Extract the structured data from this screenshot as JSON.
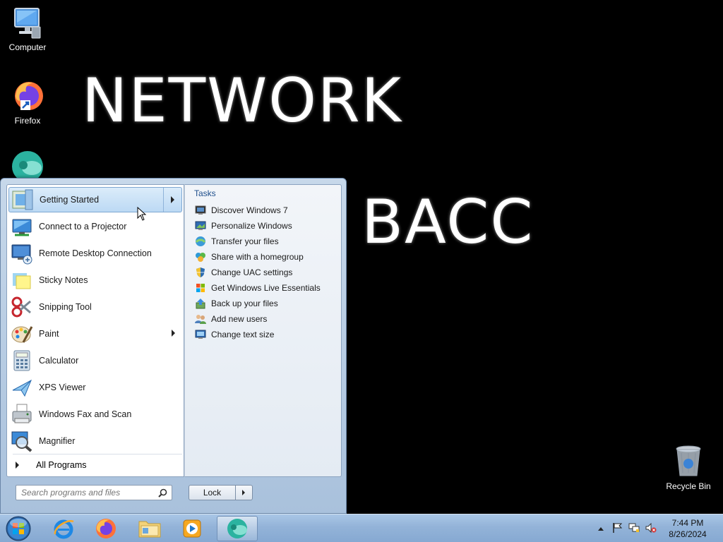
{
  "wallpaper": {
    "line1": "NETWORK",
    "line2": "BACC"
  },
  "desktop_icons": {
    "computer": "Computer",
    "firefox": "Firefox",
    "recycle_bin": "Recycle Bin"
  },
  "start_menu": {
    "pinned": [
      {
        "label": "Getting Started",
        "icon": "getting-started-icon",
        "has_submenu": true,
        "selected": true
      },
      {
        "label": "Connect to a Projector",
        "icon": "projector-icon",
        "has_submenu": false
      },
      {
        "label": "Remote Desktop Connection",
        "icon": "remote-desktop-icon",
        "has_submenu": false
      },
      {
        "label": "Sticky Notes",
        "icon": "sticky-notes-icon",
        "has_submenu": false
      },
      {
        "label": "Snipping Tool",
        "icon": "snipping-tool-icon",
        "has_submenu": false
      },
      {
        "label": "Paint",
        "icon": "paint-icon",
        "has_submenu": true
      },
      {
        "label": "Calculator",
        "icon": "calculator-icon",
        "has_submenu": false
      },
      {
        "label": "XPS Viewer",
        "icon": "xps-viewer-icon",
        "has_submenu": false
      },
      {
        "label": "Windows Fax and Scan",
        "icon": "fax-scan-icon",
        "has_submenu": false
      },
      {
        "label": "Magnifier",
        "icon": "magnifier-icon",
        "has_submenu": false
      }
    ],
    "all_programs": "All Programs",
    "tasks_header": "Tasks",
    "tasks": [
      {
        "label": "Discover Windows 7",
        "icon": "monitor-icon"
      },
      {
        "label": "Personalize Windows",
        "icon": "personalize-icon"
      },
      {
        "label": "Transfer your files",
        "icon": "transfer-icon"
      },
      {
        "label": "Share with a homegroup",
        "icon": "homegroup-icon"
      },
      {
        "label": "Change UAC settings",
        "icon": "uac-shield-icon"
      },
      {
        "label": "Get Windows Live Essentials",
        "icon": "windows-flag-icon"
      },
      {
        "label": "Back up your files",
        "icon": "backup-icon"
      },
      {
        "label": "Add new users",
        "icon": "users-icon"
      },
      {
        "label": "Change text size",
        "icon": "text-size-icon"
      }
    ],
    "search_placeholder": "Search programs and files",
    "lock_label": "Lock"
  },
  "taskbar": {
    "clock_time": "7:44 PM",
    "clock_date": "8/26/2024"
  },
  "colors": {
    "desktop_bg": "#000000",
    "taskbar": "#93b3d8",
    "selection": "#bcd9f4",
    "task_header": "#1f4e8c"
  }
}
